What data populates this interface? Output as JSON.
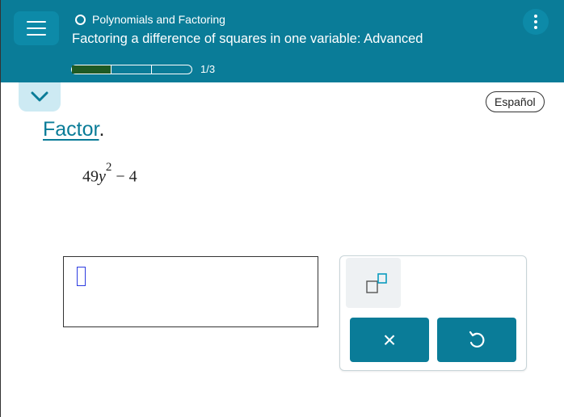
{
  "header": {
    "topic": "Polynomials and Factoring",
    "subtitle": "Factoring a difference of squares in one variable: Advanced",
    "progress_text": "1/3",
    "progress_fraction": 0.333,
    "bg_color": "#0a7c98"
  },
  "language_button": "Español",
  "problem": {
    "instruction": "Factor",
    "period": ".",
    "coefficient": "49",
    "variable": "y",
    "exponent": "2",
    "rest": " − 4"
  },
  "keypad": {
    "exponent_icon": "exponent-template-icon",
    "clear_label": "×",
    "undo_icon": "undo-icon"
  }
}
